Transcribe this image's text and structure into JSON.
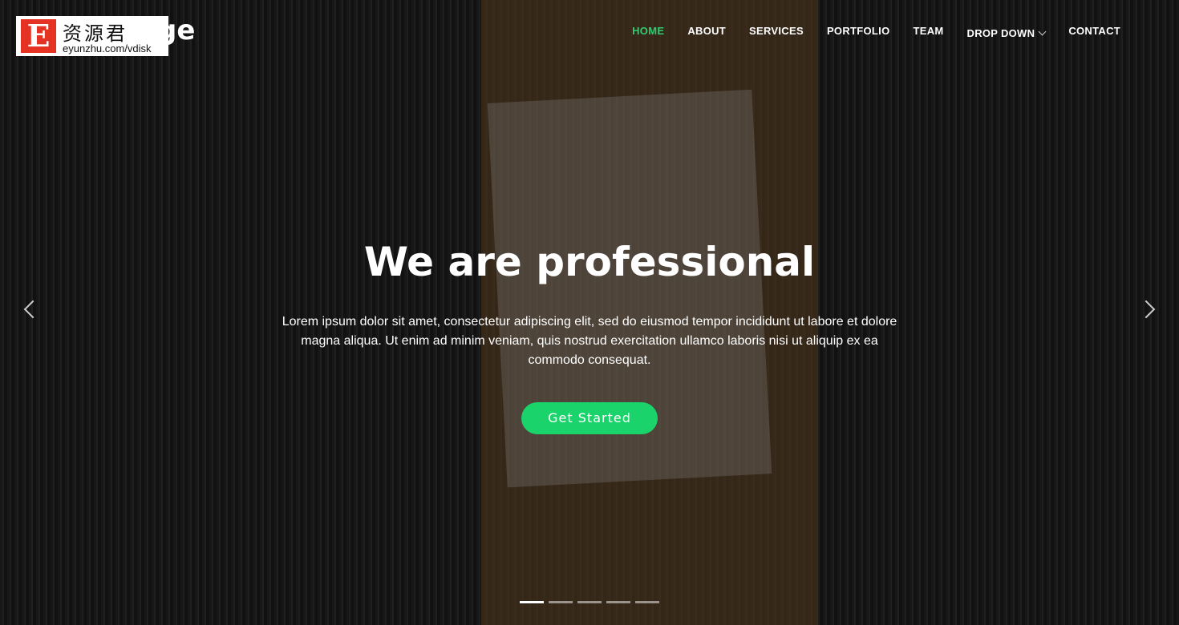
{
  "logo": {
    "visible_text": "ge"
  },
  "watermark": {
    "letter": "E",
    "chinese": "资源君",
    "url": "eyunzhu.com/vdisk"
  },
  "nav": {
    "items": [
      {
        "label": "HOME",
        "active": true
      },
      {
        "label": "ABOUT"
      },
      {
        "label": "SERVICES"
      },
      {
        "label": "PORTFOLIO"
      },
      {
        "label": "TEAM"
      },
      {
        "label": "DROP DOWN",
        "has_dropdown": true
      },
      {
        "label": "CONTACT"
      }
    ]
  },
  "hero": {
    "title": "We are professional",
    "text": "Lorem ipsum dolor sit amet, consectetur adipiscing elit, sed do eiusmod tempor incididunt ut labore et dolore magna aliqua. Ut enim ad minim veniam, quis nostrud exercitation ullamco laboris nisi ut aliquip ex ea commodo consequat.",
    "button": "Get Started"
  },
  "carousel": {
    "slides": 5,
    "active": 1
  },
  "colors": {
    "accent": "#1bd36b",
    "active_nav": "#2ecc71"
  }
}
